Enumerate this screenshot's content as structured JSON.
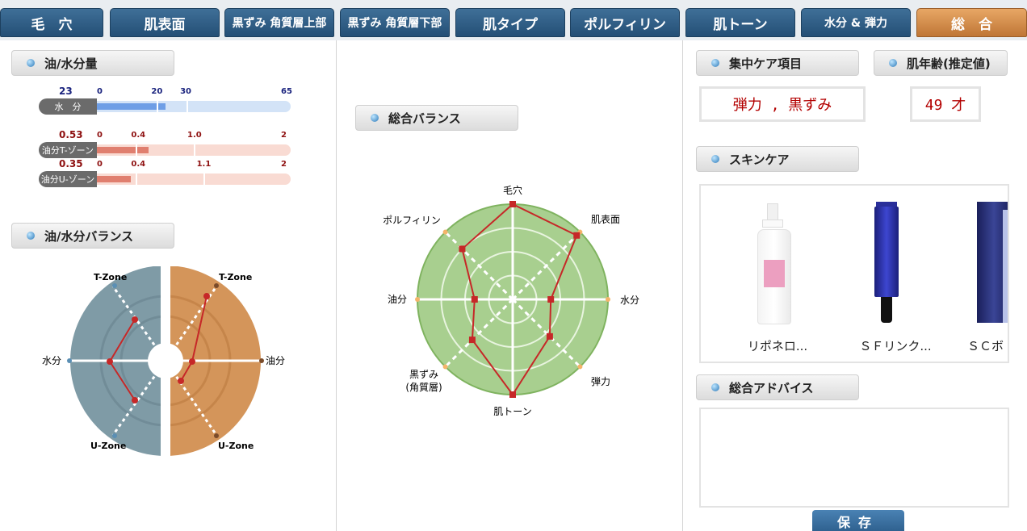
{
  "tabs": [
    {
      "label": "毛　穴",
      "active": false
    },
    {
      "label": "肌表面",
      "active": false
    },
    {
      "label": "黒ずみ 角質層上部",
      "active": false
    },
    {
      "label": "黒ずみ 角質層下部",
      "active": false
    },
    {
      "label": "肌タイプ",
      "active": false
    },
    {
      "label": "ポルフィリン",
      "active": false
    },
    {
      "label": "肌トーン",
      "active": false
    },
    {
      "label": "水分 & 弾力",
      "active": false
    },
    {
      "label": "総　合",
      "active": true
    }
  ],
  "oil_water": {
    "title": "油/水分量",
    "gauges": [
      {
        "label": "水　分",
        "value": 23,
        "value_text": "23",
        "ticks": [
          "0",
          "20",
          "30",
          "65"
        ],
        "tick_values": [
          0,
          20,
          30,
          65
        ],
        "max": 65,
        "color": "#6e9ee6",
        "track": "#d3e3f7",
        "num_color": "#1a237e"
      },
      {
        "label": "油分T-ゾーン",
        "value": 0.53,
        "value_text": "0.53",
        "ticks": [
          "0",
          "0.4",
          "1.0",
          "2"
        ],
        "tick_values": [
          0,
          0.4,
          1.0,
          2
        ],
        "max": 2,
        "color": "#e07f6f",
        "track": "#f9dbd3",
        "num_color": "#8e1010"
      },
      {
        "label": "油分U-ゾーン",
        "value": 0.35,
        "value_text": "0.35",
        "ticks": [
          "0",
          "0.4",
          "1.1",
          "2"
        ],
        "tick_values": [
          0,
          0.4,
          1.1,
          2
        ],
        "max": 2,
        "color": "#e07f6f",
        "track": "#f9dbd3",
        "num_color": "#8e1010"
      }
    ]
  },
  "balance": {
    "title": "油/水分バランス",
    "labels": {
      "t_left": "T-Zone",
      "t_right": "T-Zone",
      "u_left": "U-Zone",
      "u_right": "U-Zone",
      "water": "水分",
      "oil": "油分"
    },
    "water_color": "#7f9ba6",
    "oil_color": "#d4955a"
  },
  "overall": {
    "title": "総合バランス",
    "axes": [
      "毛穴",
      "肌表面",
      "水分",
      "弾力",
      "肌トーン",
      "黒ずみ",
      "油分",
      "ポルフィリン"
    ],
    "axis_label_lines": [
      [
        "毛穴"
      ],
      [
        "肌表面"
      ],
      [
        "水分"
      ],
      [
        "弾力"
      ],
      [
        "肌トーン"
      ],
      [
        "黒ずみ",
        "(角質層)"
      ],
      [
        "油分"
      ],
      [
        "ポルフィリン"
      ]
    ],
    "values": [
      1.0,
      0.95,
      0.4,
      0.55,
      1.0,
      0.6,
      0.4,
      0.75
    ],
    "line_color": "#c62828",
    "fill_color": "#a8cf8f"
  },
  "focus_care": {
    "title": "集中ケア項目",
    "value": "弾力 , 黒ずみ"
  },
  "skin_age": {
    "title": "肌年齢(推定値)",
    "value": "49 才"
  },
  "skincare": {
    "title": "スキンケア",
    "products": [
      {
        "name": "リポネロ..."
      },
      {
        "name": "ＳＦリンク..."
      },
      {
        "name": "ＳＣボ"
      }
    ]
  },
  "advice": {
    "title": "総合アドバイス",
    "text": ""
  },
  "save_label": "保存"
}
